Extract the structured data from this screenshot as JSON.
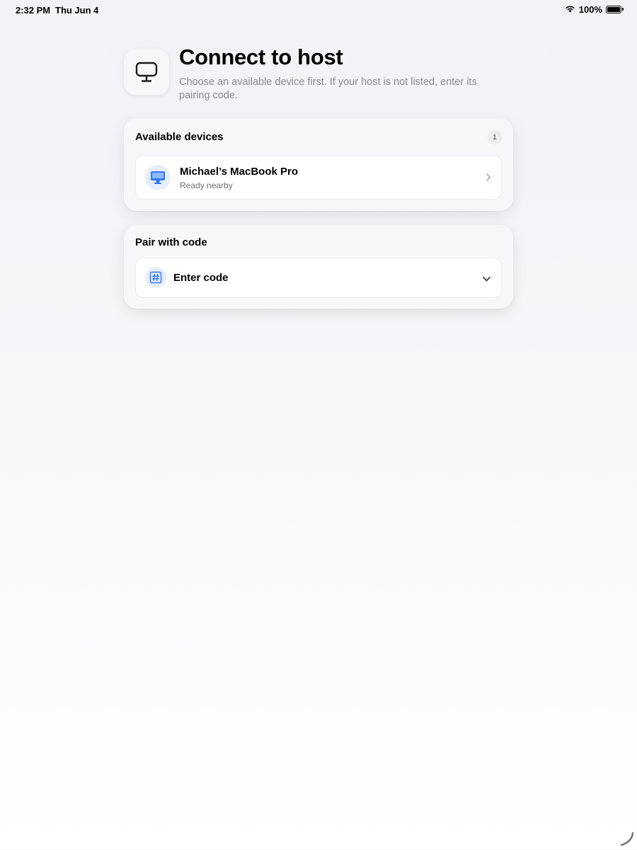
{
  "status_bar": {
    "time": "2:32 PM",
    "date": "Thu Jun 4",
    "battery": "100%",
    "battery_level": 1.0
  },
  "header": {
    "icon": "monitor-icon",
    "title": "Connect to host",
    "subtitle": "Choose an available device first. If your host is not listed, enter its pairing code."
  },
  "available_devices": {
    "title": "Available devices",
    "count": "1",
    "items": [
      {
        "name": "Michael’s MacBook Pro",
        "status": "Ready nearby",
        "icon": "desktop-computer-icon"
      }
    ]
  },
  "pair_with_code": {
    "title": "Pair with code",
    "field_label": "Enter code",
    "icon": "hash-icon"
  },
  "colors": {
    "accent": "#3478f6",
    "icon_circle_bg": "#e6eefb",
    "secondary_text": "#8a8a8e",
    "background": "#f2f2f7"
  }
}
